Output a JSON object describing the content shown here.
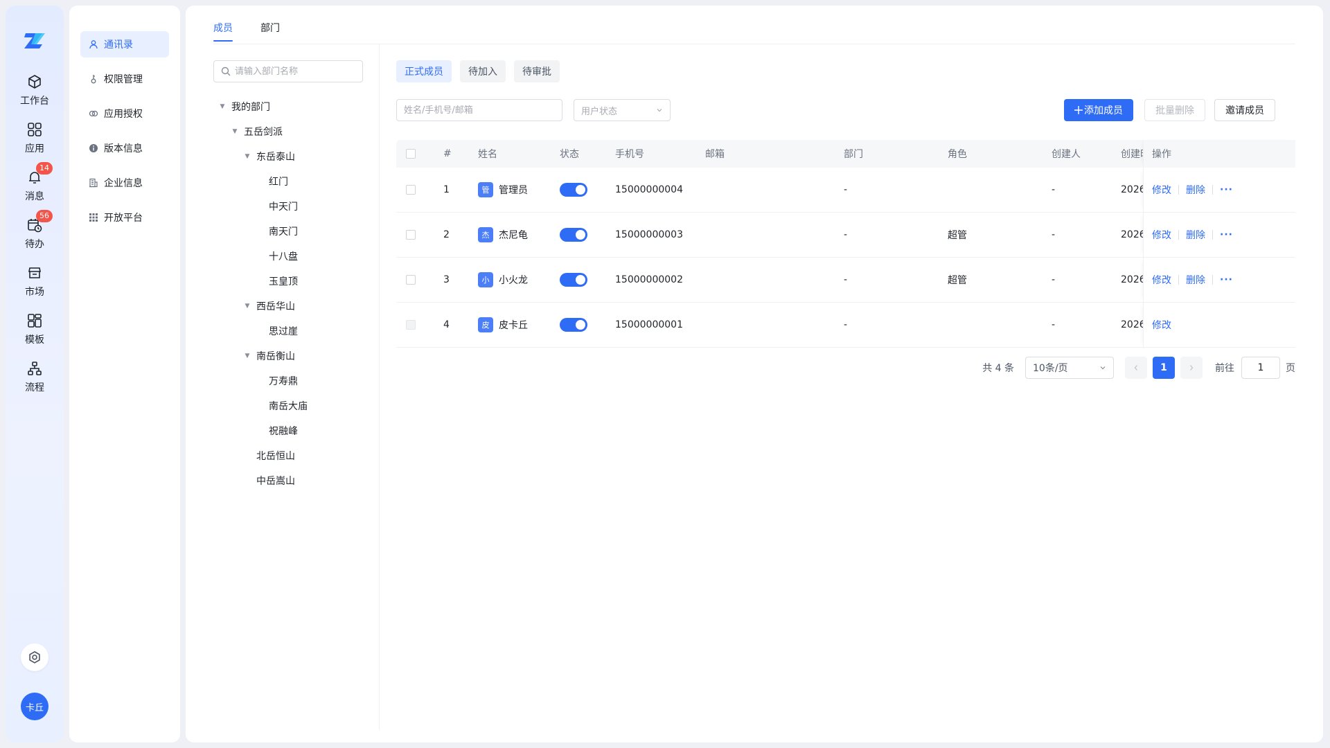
{
  "rail": {
    "items": [
      {
        "label": "工作台",
        "icon": "cube-icon"
      },
      {
        "label": "应用",
        "icon": "grid-icon"
      },
      {
        "label": "消息",
        "icon": "bell-icon",
        "badge": "14"
      },
      {
        "label": "待办",
        "icon": "calendar-clock-icon",
        "badge": "56"
      },
      {
        "label": "市场",
        "icon": "store-icon"
      },
      {
        "label": "模板",
        "icon": "template-icon"
      },
      {
        "label": "流程",
        "icon": "flow-icon"
      }
    ],
    "avatar_text": "卡丘"
  },
  "subnav": {
    "items": [
      {
        "label": "通讯录",
        "icon": "user-icon",
        "active": true
      },
      {
        "label": "权限管理",
        "icon": "key-icon"
      },
      {
        "label": "应用授权",
        "icon": "link-icon"
      },
      {
        "label": "版本信息",
        "icon": "info-icon"
      },
      {
        "label": "企业信息",
        "icon": "building-icon"
      },
      {
        "label": "开放平台",
        "icon": "apps-icon"
      }
    ]
  },
  "tabs": [
    "成员",
    "部门"
  ],
  "dept": {
    "search_placeholder": "请输入部门名称",
    "tree": [
      {
        "label": "我的部门",
        "level": 0,
        "expanded": true
      },
      {
        "label": "五岳剑派",
        "level": 1,
        "expanded": true
      },
      {
        "label": "东岳泰山",
        "level": 2,
        "expanded": true
      },
      {
        "label": "红门",
        "level": 3
      },
      {
        "label": "中天门",
        "level": 3
      },
      {
        "label": "南天门",
        "level": 3
      },
      {
        "label": "十八盘",
        "level": 3
      },
      {
        "label": "玉皇顶",
        "level": 3
      },
      {
        "label": "西岳华山",
        "level": 2,
        "expanded": true
      },
      {
        "label": "思过崖",
        "level": 3
      },
      {
        "label": "南岳衡山",
        "level": 2,
        "expanded": true
      },
      {
        "label": "万寿鼎",
        "level": 3
      },
      {
        "label": "南岳大庙",
        "level": 3
      },
      {
        "label": "祝融峰",
        "level": 3
      },
      {
        "label": "北岳恒山",
        "level": 2
      },
      {
        "label": "中岳嵩山",
        "level": 2
      }
    ]
  },
  "segments": [
    "正式成员",
    "待加入",
    "待审批"
  ],
  "filters": {
    "search_placeholder": "姓名/手机号/邮箱",
    "status_placeholder": "用户状态"
  },
  "actions": {
    "add": "添加成员",
    "batch_delete": "批量删除",
    "invite": "邀请成员"
  },
  "table": {
    "headers": {
      "index": "#",
      "name": "姓名",
      "status": "状态",
      "phone": "手机号",
      "email": "邮箱",
      "dept": "部门",
      "role": "角色",
      "creator": "创建人",
      "created": "创建时间",
      "ops": "操作"
    },
    "rows": [
      {
        "index": "1",
        "avatar": "管",
        "name": "管理员",
        "phone": "15000000004",
        "email": "",
        "dept": "-",
        "role": "",
        "creator": "-",
        "created": "2026",
        "edit": "修改",
        "delete": "删除",
        "more": "···"
      },
      {
        "index": "2",
        "avatar": "杰",
        "name": "杰尼龟",
        "phone": "15000000003",
        "email": "",
        "dept": "-",
        "role": "超管",
        "creator": "-",
        "created": "2026",
        "edit": "修改",
        "delete": "删除",
        "more": "···"
      },
      {
        "index": "3",
        "avatar": "小",
        "name": "小火龙",
        "phone": "15000000002",
        "email": "",
        "dept": "-",
        "role": "超管",
        "creator": "-",
        "created": "2026",
        "edit": "修改",
        "delete": "删除",
        "more": "···"
      },
      {
        "index": "4",
        "avatar": "皮",
        "name": "皮卡丘",
        "phone": "15000000001",
        "email": "",
        "dept": "-",
        "role": "",
        "creator": "-",
        "created": "2026",
        "edit": "修改"
      }
    ]
  },
  "pagination": {
    "total": "共 4 条",
    "page_size": "10条/页",
    "current": "1",
    "goto_label": "前往",
    "goto_value": "1",
    "page_suffix": "页"
  },
  "colors": {
    "primary": "#2f6cf6",
    "badge": "#f2564b"
  }
}
